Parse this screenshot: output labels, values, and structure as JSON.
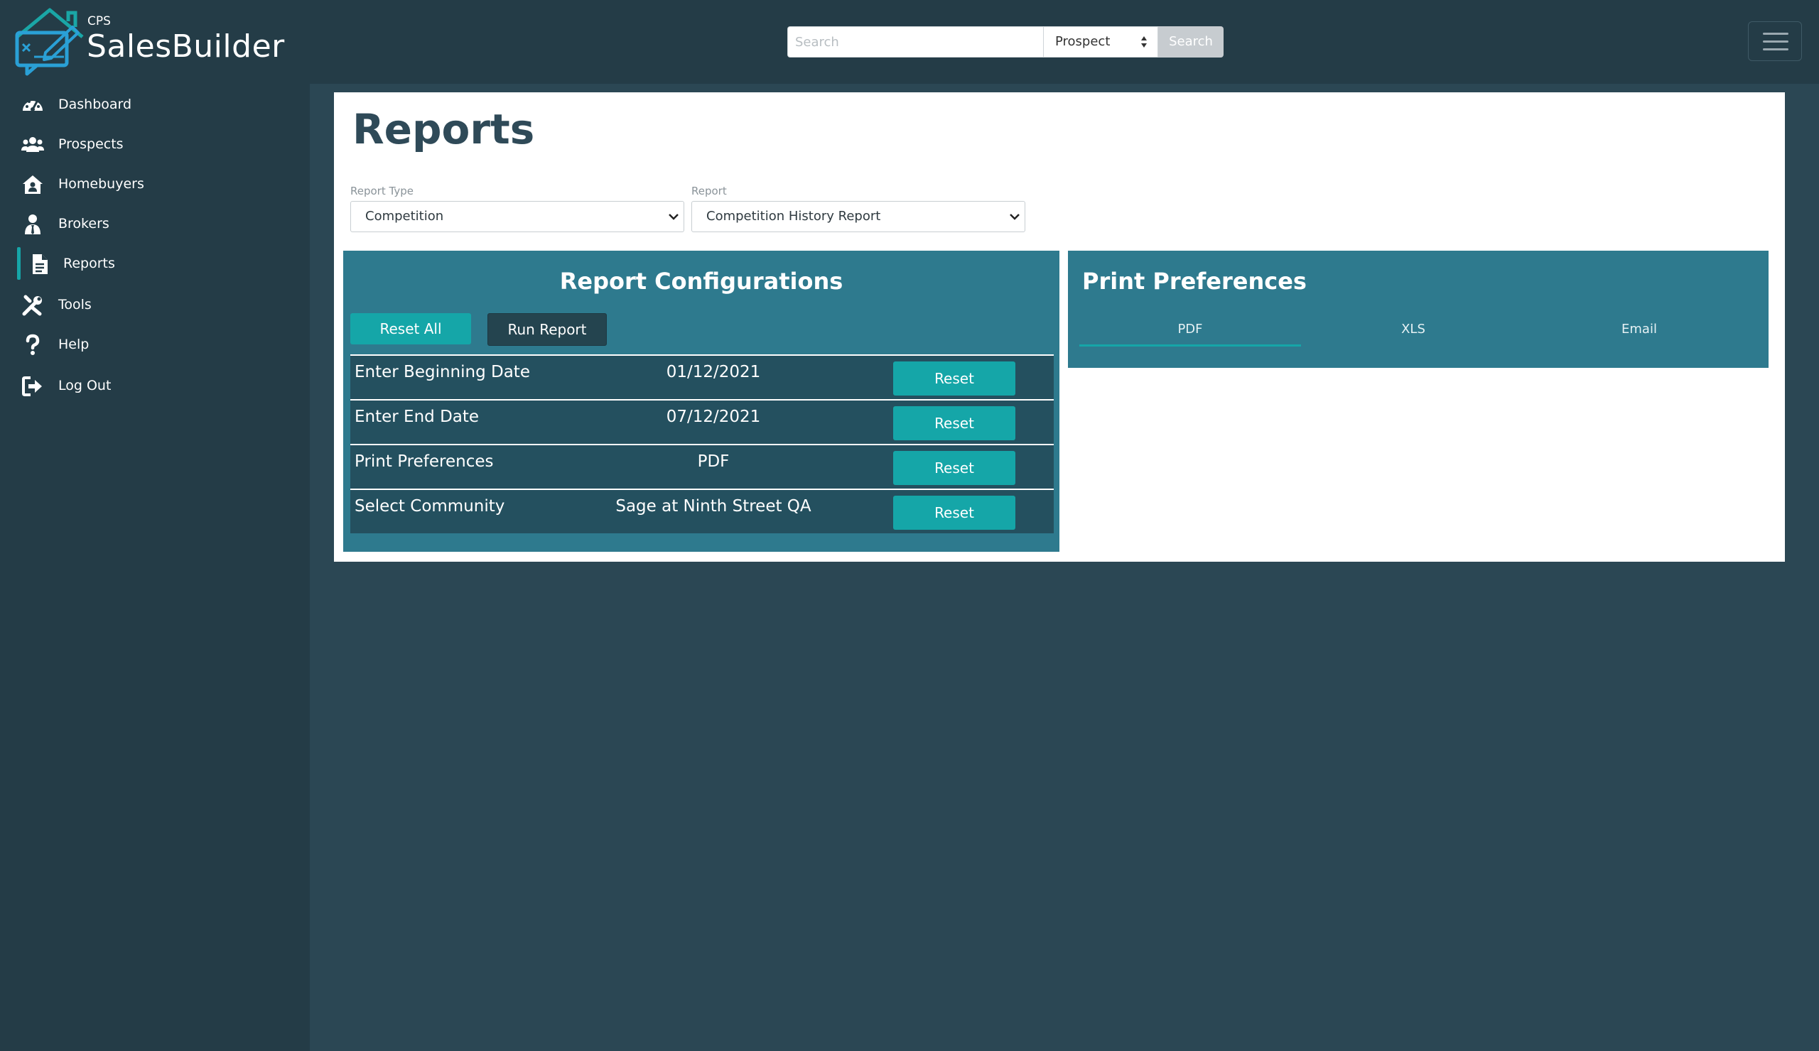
{
  "app": {
    "brand_small": "CPS",
    "brand_name": "SalesBuilder"
  },
  "search": {
    "placeholder": "Search",
    "type_selected": "Prospect",
    "button_label": "Search"
  },
  "sidebar": {
    "items": [
      {
        "label": "Dashboard",
        "icon": "dashboard-icon"
      },
      {
        "label": "Prospects",
        "icon": "users-icon"
      },
      {
        "label": "Homebuyers",
        "icon": "house-user-icon"
      },
      {
        "label": "Brokers",
        "icon": "user-tie-icon"
      },
      {
        "label": "Reports",
        "icon": "file-icon",
        "active": true
      },
      {
        "label": "Tools",
        "icon": "tools-icon"
      },
      {
        "label": "Help",
        "icon": "question-icon"
      },
      {
        "label": "Log Out",
        "icon": "sign-out-icon"
      }
    ]
  },
  "page": {
    "title": "Reports",
    "report_type_label": "Report Type",
    "report_type_value": "Competition",
    "report_label": "Report",
    "report_value": "Competition History Report"
  },
  "config": {
    "title": "Report Configurations",
    "reset_all_label": "Reset All",
    "run_report_label": "Run Report",
    "rows": [
      {
        "name": "Enter Beginning Date",
        "value": "01/12/2021",
        "reset": "Reset"
      },
      {
        "name": "Enter End Date",
        "value": "07/12/2021",
        "reset": "Reset"
      },
      {
        "name": "Print Preferences",
        "value": "PDF",
        "reset": "Reset"
      },
      {
        "name": "Select Community",
        "value": "Sage at Ninth Street QA",
        "reset": "Reset"
      }
    ]
  },
  "print": {
    "title": "Print Preferences",
    "tabs": [
      {
        "label": "PDF",
        "active": true
      },
      {
        "label": "XLS"
      },
      {
        "label": "Email"
      }
    ]
  },
  "colors": {
    "page_bg": "#2b4754",
    "sidebar_bg": "#243c47",
    "panel": "#2e7a8e",
    "accent": "#15a6a8",
    "title": "#2f4a58"
  }
}
